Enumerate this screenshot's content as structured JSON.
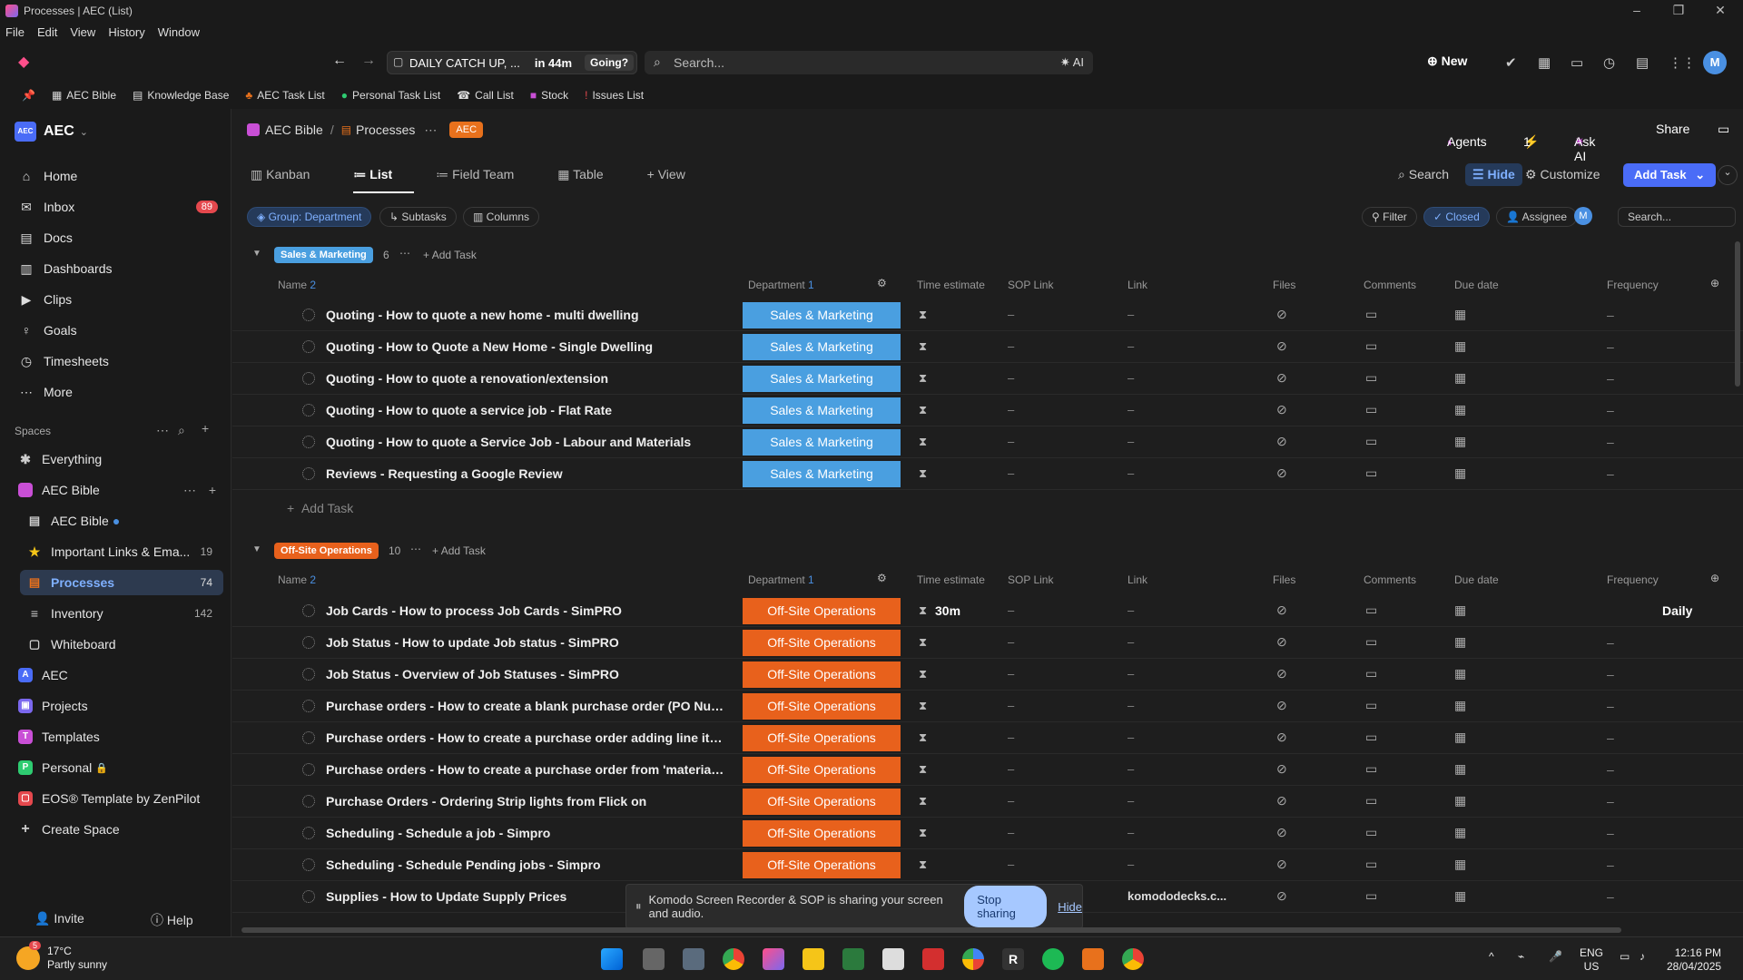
{
  "window": {
    "title": "Processes | AEC (List)"
  },
  "menu": [
    "File",
    "Edit",
    "View",
    "History",
    "Window"
  ],
  "topbar": {
    "meeting_title": "DAILY CATCH UP, ...",
    "meeting_time": "in 44m",
    "meeting_action": "Going?",
    "search_placeholder": "Search...",
    "ai_label": "AI",
    "new_label": "New",
    "avatar": "M"
  },
  "bookmarks": [
    {
      "icon": "▦",
      "label": "AEC Bible",
      "color": "#cccccc"
    },
    {
      "icon": "▤",
      "label": "Knowledge Base",
      "color": "#cccccc"
    },
    {
      "icon": "♣",
      "label": "AEC Task List",
      "color": "#e8711c"
    },
    {
      "icon": "●",
      "label": "Personal Task List",
      "color": "#2ecc71"
    },
    {
      "icon": "☎",
      "label": "Call List",
      "color": "#cccccc"
    },
    {
      "icon": "■",
      "label": "Stock",
      "color": "#c94fd6"
    },
    {
      "icon": "!",
      "label": "Issues List",
      "color": "#e5484d"
    }
  ],
  "sidebar": {
    "workspace": {
      "logo": "AEC",
      "name": "AEC"
    },
    "nav": [
      {
        "icon": "⌂",
        "label": "Home"
      },
      {
        "icon": "✉",
        "label": "Inbox",
        "badge": "89"
      },
      {
        "icon": "▤",
        "label": "Docs"
      },
      {
        "icon": "▥",
        "label": "Dashboards"
      },
      {
        "icon": "▶",
        "label": "Clips"
      },
      {
        "icon": "♀",
        "label": "Goals"
      },
      {
        "icon": "◷",
        "label": "Timesheets"
      },
      {
        "icon": "⋯",
        "label": "More"
      }
    ],
    "spaces_header": "Spaces",
    "spaces": [
      {
        "icon": "✱",
        "label": "Everything",
        "indent": 0,
        "color": ""
      },
      {
        "icon": "",
        "label": "AEC Bible",
        "indent": 0,
        "color": "#c94fd6"
      },
      {
        "icon": "▤",
        "label": "AEC Bible",
        "indent": 1,
        "color": ""
      },
      {
        "icon": "★",
        "label": "Important Links & Ema...",
        "indent": 1,
        "color": "",
        "count": "19"
      },
      {
        "icon": "▤",
        "label": "Processes",
        "indent": 1,
        "color": "",
        "count": "74",
        "selected": true
      },
      {
        "icon": "≡",
        "label": "Inventory",
        "indent": 1,
        "color": "",
        "count": "142"
      },
      {
        "icon": "▢",
        "label": "Whiteboard",
        "indent": 1,
        "color": ""
      },
      {
        "icon": "A",
        "label": "AEC",
        "indent": 0,
        "color": "#4a6cf7"
      },
      {
        "icon": "▣",
        "label": "Projects",
        "indent": 0,
        "color": "#7b68ee"
      },
      {
        "icon": "T",
        "label": "Templates",
        "indent": 0,
        "color": "#c94fd6"
      },
      {
        "icon": "P",
        "label": "Personal",
        "indent": 0,
        "color": "#2ecc71"
      },
      {
        "icon": "▢",
        "label": "EOS® Template by ZenPilot",
        "indent": 0,
        "color": "#e5484d"
      },
      {
        "icon": "+",
        "label": "Create Space",
        "indent": 0,
        "color": ""
      }
    ],
    "invite": "Invite",
    "help": "Help"
  },
  "main": {
    "breadcrumb": [
      "AEC Bible",
      "Processes"
    ],
    "tag": "AEC",
    "agents": "Agents",
    "bolt_count": "1",
    "ask_ai": "Ask AI",
    "share": "Share",
    "views": [
      "Kanban",
      "List",
      "Field Team",
      "Table",
      "View"
    ],
    "search": "Search",
    "hide": "Hide",
    "customize": "Customize",
    "add_task": "Add Task",
    "chips": {
      "group": "Group: Department",
      "subtasks": "Subtasks",
      "columns": "Columns"
    },
    "filter": "Filter",
    "closed": "Closed",
    "assignee": "Assignee",
    "list_search": "Search...",
    "columns": {
      "name": "Name",
      "name_sort": "2",
      "department": "Department",
      "dept_sort": "1",
      "time": "Time estimate",
      "sop": "SOP Link",
      "link": "Link",
      "files": "Files",
      "comments": "Comments",
      "due": "Due date",
      "freq": "Frequency"
    },
    "add_task_label": "Add Task",
    "groups": [
      {
        "label": "Sales & Marketing",
        "count": "6",
        "color": "#4a9fe0",
        "tasks": [
          {
            "name": "Quoting - How to quote a new home - multi dwelling",
            "time": "",
            "freq": "–"
          },
          {
            "name": "Quoting - How to Quote a New Home - Single Dwelling",
            "time": "",
            "freq": "–"
          },
          {
            "name": "Quoting - How to quote a renovation/extension",
            "time": "",
            "freq": "–"
          },
          {
            "name": "Quoting - How to quote a service job - Flat Rate",
            "time": "",
            "freq": "–"
          },
          {
            "name": "Quoting - How to quote a Service Job - Labour and Materials",
            "time": "",
            "freq": "–"
          },
          {
            "name": "Reviews - Requesting a Google Review",
            "time": "",
            "freq": "–"
          }
        ]
      },
      {
        "label": "Off-Site Operations",
        "count": "10",
        "color": "#e8611c",
        "tasks": [
          {
            "name": "Job Cards - How to process Job Cards - SimPRO",
            "time": "30m",
            "freq": "Daily"
          },
          {
            "name": "Job Status - How to update Job status - SimPRO",
            "time": "",
            "freq": "–"
          },
          {
            "name": "Job Status - Overview of Job Statuses - SimPRO",
            "time": "",
            "freq": "–"
          },
          {
            "name": "Purchase orders - How to create a blank purchase order (PO Numbe...",
            "time": "",
            "freq": "–"
          },
          {
            "name": "Purchase orders - How to create a purchase order adding line items ...",
            "time": "",
            "freq": "–"
          },
          {
            "name": "Purchase orders - How to create a purchase order from 'material req...",
            "time": "",
            "freq": "–"
          },
          {
            "name": "Purchase Orders - Ordering Strip lights from Flick on",
            "time": "",
            "freq": "–"
          },
          {
            "name": "Scheduling - Schedule a job - Simpro",
            "time": "",
            "freq": "–"
          },
          {
            "name": "Scheduling - Schedule Pending jobs - Simpro",
            "time": "",
            "freq": "–"
          },
          {
            "name": "Supplies - How to Update Supply Prices",
            "time": "",
            "freq": "–"
          }
        ]
      }
    ],
    "link_text": "komododecks.c..."
  },
  "share_banner": {
    "text": "Komodo Screen Recorder & SOP is sharing your screen and audio.",
    "stop": "Stop sharing",
    "hide": "Hide"
  },
  "taskbar": {
    "temp": "17°C",
    "weather": "Partly sunny",
    "weather_badge": "5",
    "lang1": "ENG",
    "lang2": "US",
    "time": "12:16 PM",
    "date": "28/04/2025"
  }
}
